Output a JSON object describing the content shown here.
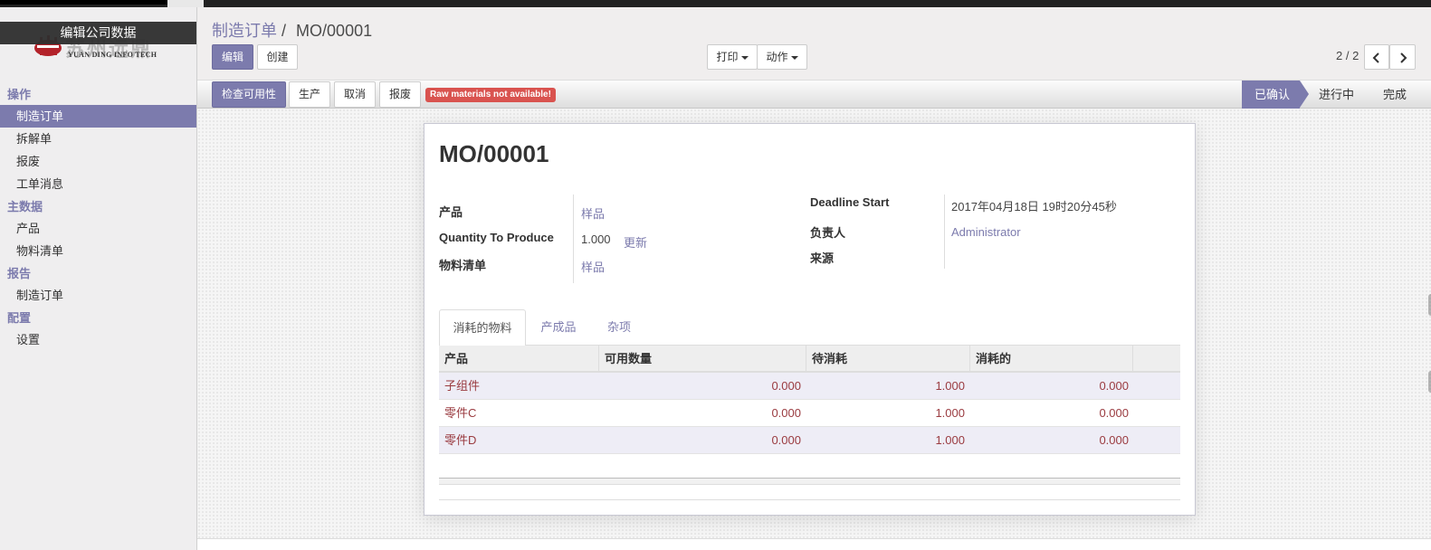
{
  "sidebar": {
    "company_edit": "编辑公司数据",
    "logo_cn": "苏州远鼎",
    "logo_en": "YUAN DING INFO TECH",
    "sections": [
      {
        "title": "操作",
        "items": [
          "制造订单",
          "拆解单",
          "报废",
          "工单消息"
        ]
      },
      {
        "title": "主数据",
        "items": [
          "产品",
          "物料清单"
        ]
      },
      {
        "title": "报告",
        "items": [
          "制造订单"
        ]
      },
      {
        "title": "配置",
        "items": [
          "设置"
        ]
      }
    ]
  },
  "breadcrumb": {
    "parent": "制造订单",
    "sep": "/",
    "current": "MO/00001"
  },
  "toolbar": {
    "edit": "编辑",
    "create": "创建",
    "print": "打印",
    "action": "动作"
  },
  "pager": {
    "value": "2 / 2",
    "prev_icon": "chevron-left",
    "next_icon": "chevron-right"
  },
  "statusbar": {
    "check": "检查可用性",
    "produce": "生产",
    "cancel": "取消",
    "scrap": "报废",
    "warning": "Raw materials not available!",
    "stages": [
      "已确认",
      "进行中",
      "完成"
    ],
    "current_stage": "已确认"
  },
  "record": {
    "name": "MO/00001",
    "fields": {
      "product_label": "产品",
      "product_value": "样品",
      "qty_label": "Quantity To Produce",
      "qty_value": "1.000",
      "qty_update": "更新",
      "bom_label": "物料清单",
      "bom_value": "样品",
      "deadline_label": "Deadline Start",
      "deadline_value": "2017年04月18日 19时20分45秒",
      "responsible_label": "负责人",
      "responsible_value": "Administrator",
      "source_label": "来源"
    }
  },
  "tabs": [
    "消耗的物料",
    "产成品",
    "杂项"
  ],
  "table": {
    "columns": [
      "产品",
      "可用数量",
      "待消耗",
      "消耗的"
    ],
    "rows": [
      {
        "product": "子组件",
        "available": "0.000",
        "to_consume": "1.000",
        "consumed": "0.000"
      },
      {
        "product": "零件C",
        "available": "0.000",
        "to_consume": "1.000",
        "consumed": "0.000"
      },
      {
        "product": "零件D",
        "available": "0.000",
        "to_consume": "1.000",
        "consumed": "0.000"
      }
    ]
  },
  "colors": {
    "accent": "#7c7bad",
    "warning": "#d9534f",
    "row_text": "#9a3b40"
  }
}
